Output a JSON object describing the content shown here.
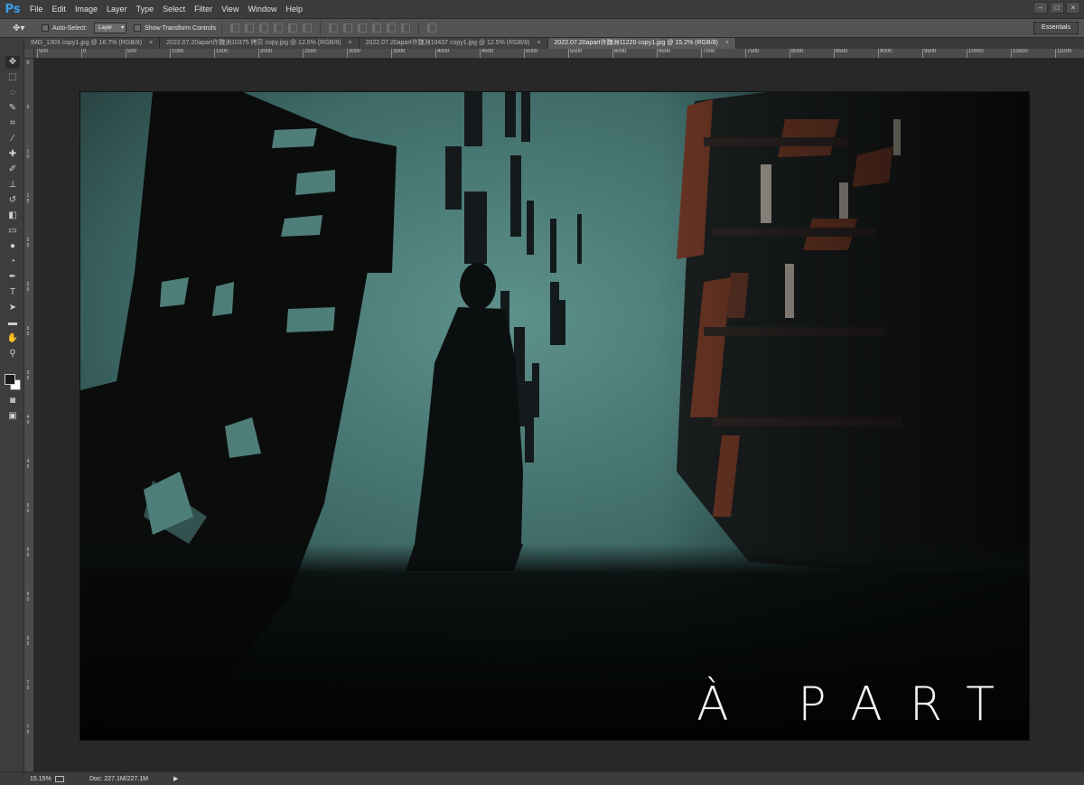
{
  "app": {
    "logo": "Ps"
  },
  "menu": [
    "File",
    "Edit",
    "Image",
    "Layer",
    "Type",
    "Select",
    "Filter",
    "View",
    "Window",
    "Help"
  ],
  "window_controls": [
    "–",
    "□",
    "×"
  ],
  "options": {
    "auto_select_label": "Auto-Select:",
    "auto_select_value": "Layer",
    "show_transform_label": "Show Transform Controls",
    "workspace": "Essentials"
  },
  "tabs": [
    {
      "label": "IMG_1303 copy1.jpg @ 16.7% (RGB/8)",
      "close": "×"
    },
    {
      "label": "2022.07.20apart许魏洲10375 拷贝 copy.jpg @ 12.5% (RGB/8)",
      "close": "×"
    },
    {
      "label": "2022.07.20apart许魏洲10437 copy1.jpg @ 12.5% (RGB/8)",
      "close": "×"
    },
    {
      "label": "2022.07.20apart许魏洲11220 copy1.jpg @ 15.2% (RGB/8)",
      "close": "×"
    }
  ],
  "ruler_h": [
    "500",
    "0",
    "500",
    "1000",
    "1500",
    "2000",
    "2500",
    "3000",
    "3500",
    "4000",
    "4500",
    "5000",
    "5500",
    "6000",
    "6500",
    "7000",
    "7500",
    "8000",
    "8500",
    "9000",
    "9500",
    "10000",
    "10500",
    "11000"
  ],
  "ruler_v": [
    "0",
    "5",
    "1 0",
    "1 5",
    "2 0",
    "2 5",
    "3 0",
    "3 5",
    "4 0",
    "4 5",
    "5 0",
    "5 5",
    "6 0",
    "6 5",
    "7 0",
    "7 5"
  ],
  "artwork": {
    "title": "À PART"
  },
  "colors": {
    "wall": "#3f6d6a",
    "shelf": "#5a2e1e",
    "accent": "#3a9ee8"
  },
  "status": {
    "zoom": "15.15%",
    "doc": "Doc: 227.1M/227.1M",
    "arrow": "▶"
  }
}
